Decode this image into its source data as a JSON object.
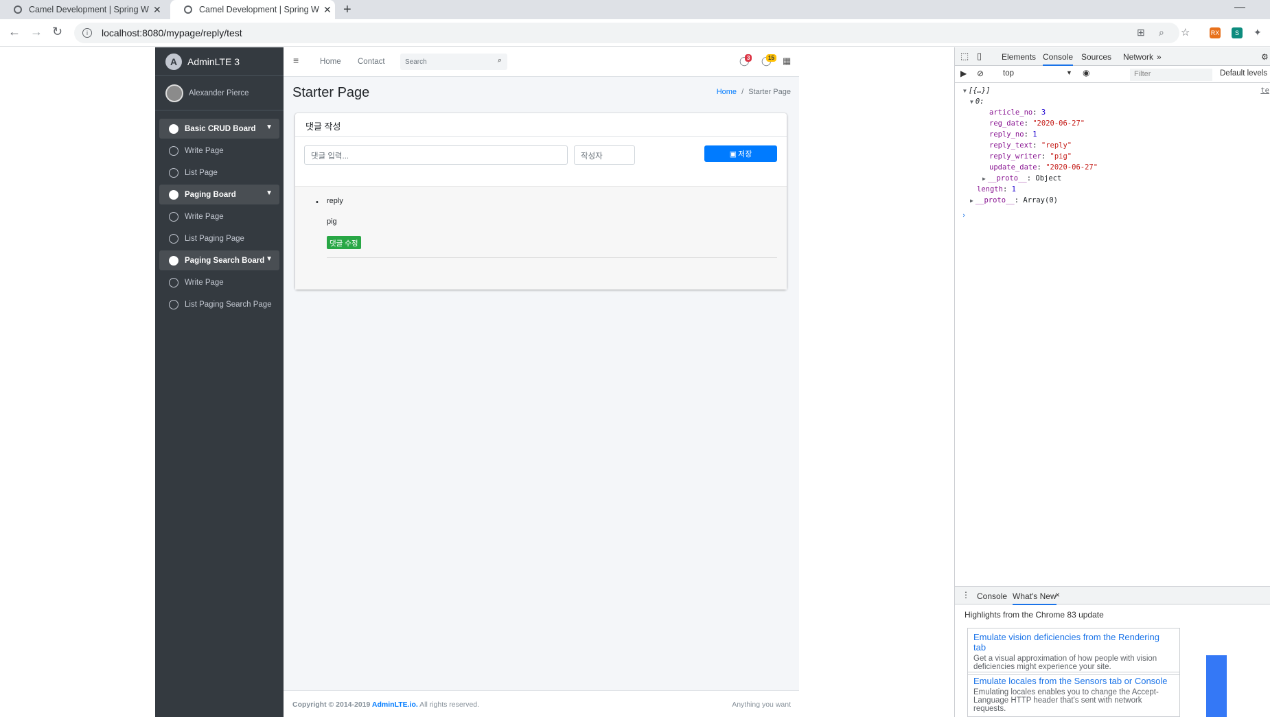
{
  "browser": {
    "tabs": [
      {
        "title": "Camel Development | Spring W",
        "active": false
      },
      {
        "title": "Camel Development | Spring W",
        "active": true
      }
    ],
    "url": "localhost:8080/mypage/reply/test",
    "extensions": [
      "RX",
      "S"
    ]
  },
  "sidebar": {
    "brand": "AdminLTE 3",
    "user": "Alexander Pierce",
    "items": [
      {
        "label": "Basic CRUD Board",
        "type": "header"
      },
      {
        "label": "Write Page",
        "type": "link"
      },
      {
        "label": "List Page",
        "type": "link"
      },
      {
        "label": "Paging Board",
        "type": "header"
      },
      {
        "label": "Write Page",
        "type": "link"
      },
      {
        "label": "List Paging Page",
        "type": "link"
      },
      {
        "label": "Paging Search Board",
        "type": "header"
      },
      {
        "label": "Write Page",
        "type": "link"
      },
      {
        "label": "List Paging Search Page",
        "type": "link"
      }
    ]
  },
  "topnav": {
    "menu_icon": "≡",
    "home": "Home",
    "contact": "Contact",
    "search_placeholder": "Search",
    "messages_count": "3",
    "notifications_count": "15"
  },
  "page": {
    "title": "Starter Page",
    "breadcrumb_home": "Home",
    "breadcrumb_sep": "/",
    "breadcrumb_current": "Starter Page"
  },
  "card": {
    "header": "댓글 작성",
    "reply_placeholder": "댓글 입력...",
    "writer_placeholder": "작성자",
    "save_label": "저장",
    "reply_text": "reply",
    "reply_writer": "pig",
    "modify_label": "댓글 수정"
  },
  "footer": {
    "copyright_prefix": "Copyright © 2014-2019 ",
    "copyright_link": "AdminLTE.io.",
    "copyright_suffix": " All rights reserved.",
    "right": "Anything you want"
  },
  "devtools": {
    "tabs": [
      "Elements",
      "Console",
      "Sources",
      "Network"
    ],
    "active_tab": "Console",
    "more": "»",
    "context": "top",
    "filter_placeholder": "Filter",
    "levels": "Default levels",
    "source_link": "te",
    "lines": [
      {
        "indent": 0,
        "prefix": "▼",
        "text": "[{…}]"
      },
      {
        "indent": 1,
        "prefix": "▼",
        "text": "0:"
      },
      {
        "indent": 2,
        "key": "article_no",
        "val": "3",
        "kind": "num"
      },
      {
        "indent": 2,
        "key": "reg_date",
        "val": "\"2020-06-27\"",
        "kind": "str"
      },
      {
        "indent": 2,
        "key": "reply_no",
        "val": "1",
        "kind": "num"
      },
      {
        "indent": 2,
        "key": "reply_text",
        "val": "\"reply\"",
        "kind": "str"
      },
      {
        "indent": 2,
        "key": "reply_writer",
        "val": "\"pig\"",
        "kind": "str"
      },
      {
        "indent": 2,
        "key": "update_date",
        "val": "\"2020-06-27\"",
        "kind": "str"
      },
      {
        "indent": 2,
        "prefix": "▶",
        "key": "__proto__",
        "val": "Object",
        "kind": "plain"
      },
      {
        "indent": 1,
        "key": "length",
        "val": "1",
        "kind": "num"
      },
      {
        "indent": 1,
        "prefix": "▶",
        "key": "__proto__",
        "val": "Array(0)",
        "kind": "plain"
      }
    ],
    "prompt": "›",
    "drawer_tabs": [
      "Console",
      "What's New"
    ],
    "drawer_close": "×",
    "whats_new_heading": "Highlights from the Chrome 83 update",
    "whats_new": [
      {
        "title": "Emulate vision deficiencies from the Rendering tab",
        "desc": "Get a visual approximation of how people with vision deficiencies might experience your site."
      },
      {
        "title": "Emulate locales from the Sensors tab or Console",
        "desc": "Emulating locales enables you to change the Accept-Language HTTP header that's sent with network requests."
      }
    ]
  }
}
